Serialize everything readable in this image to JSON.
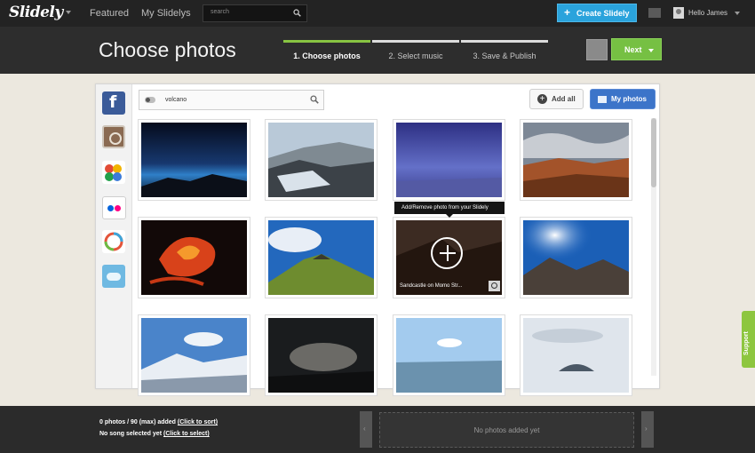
{
  "topbar": {
    "logo": "Slidely",
    "nav": [
      "Featured",
      "My Slidelys"
    ],
    "search_placeholder": "search",
    "create_button": "Create Slidely",
    "user_name": "Hello James"
  },
  "header": {
    "title": "Choose photos",
    "steps": [
      {
        "label": "1. Choose photos",
        "active": true
      },
      {
        "label": "2. Select music",
        "active": false
      },
      {
        "label": "3. Save & Publish",
        "active": false
      }
    ],
    "next_button": "Next"
  },
  "sources": [
    {
      "name": "facebook-icon"
    },
    {
      "name": "instagram-icon"
    },
    {
      "name": "google-plus-icon"
    },
    {
      "name": "flickr-icon"
    },
    {
      "name": "picasa-icon"
    },
    {
      "name": "upload-cloud-icon"
    }
  ],
  "photo_search": {
    "query": "volcano"
  },
  "add_all_button": "Add all",
  "my_photos_button": "My photos",
  "tooltip": "Add/Remove photo from your Slidely",
  "hovered_caption": "Sandcastle on Momo Str...",
  "photos": [
    {
      "id": "p1",
      "colors": [
        "#0a1a35",
        "#15336a"
      ]
    },
    {
      "id": "p2",
      "colors": [
        "#dfe8f1",
        "#3a4650"
      ]
    },
    {
      "id": "p3",
      "colors": [
        "#3b3d92",
        "#7e86d8"
      ]
    },
    {
      "id": "p4",
      "colors": [
        "#6d7787",
        "#ae5b2c"
      ]
    },
    {
      "id": "p5",
      "colors": [
        "#1a0e0c",
        "#e0461b"
      ]
    },
    {
      "id": "p6",
      "colors": [
        "#1e64b8",
        "#5c8a2e"
      ]
    },
    {
      "id": "p7",
      "colors": [
        "#4d3527",
        "#261a14"
      ]
    },
    {
      "id": "p8",
      "colors": [
        "#1a5fb8",
        "#4b4039"
      ]
    },
    {
      "id": "p9",
      "colors": [
        "#4a82c8",
        "#e8eef5"
      ]
    },
    {
      "id": "p10",
      "colors": [
        "#1b1d1f",
        "#6b6a66"
      ]
    },
    {
      "id": "p11",
      "colors": [
        "#9cc6ea",
        "#6a8ea7"
      ]
    },
    {
      "id": "p12",
      "colors": [
        "#e0e6ec",
        "#8899aa"
      ]
    }
  ],
  "support_tab": "Support",
  "bottombar": {
    "count_prefix": "0 photos / 90 (max) added",
    "count_link": "(Click to sort)",
    "song_prefix": "No song selected yet",
    "song_link": "(Click to select)",
    "tray_empty": "No photos added yet"
  }
}
